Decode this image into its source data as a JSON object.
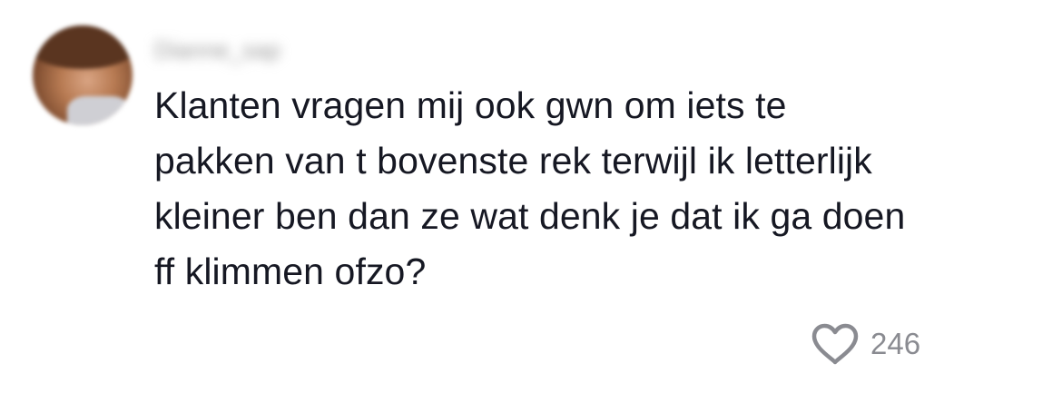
{
  "comment": {
    "username": "Dianne_sap",
    "text_lines": [
      "Klanten vragen mij ook gwn om iets te",
      "pakken van t bovenste rek terwijl ik letterlijk",
      "kleiner ben dan ze wat denk je dat ik ga doen",
      "ff klimmen ofzo?"
    ],
    "like_count": "246",
    "like_icon": "heart-outline-icon"
  },
  "colors": {
    "text": "#161823",
    "muted": "#8a8b91",
    "background": "#ffffff"
  }
}
